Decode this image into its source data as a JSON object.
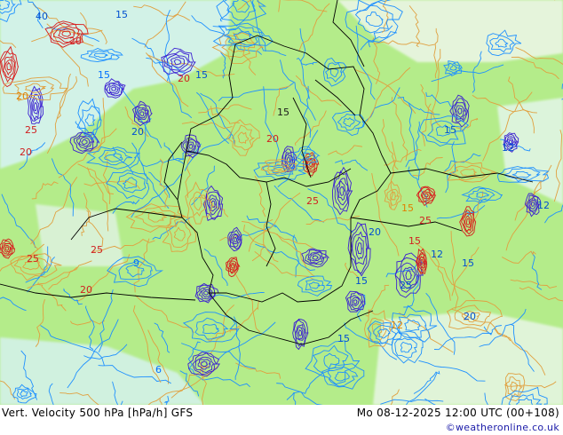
{
  "map": {
    "contour_labels": [
      "40",
      "20",
      "15",
      "20",
      "25",
      "20",
      "15",
      "15",
      "20",
      "25",
      "20",
      "15",
      "25",
      "15",
      "12",
      "25",
      "15",
      "20",
      "12",
      "15",
      "12",
      "20",
      "15",
      "20",
      "25",
      "25",
      "20",
      "15",
      "12",
      "15",
      "9",
      "6"
    ],
    "colors": {
      "background": "#b4ec8a",
      "positive_lines": "#1e90ff",
      "strong_positive_lines": "#3b1fd1",
      "negative_lines": "#e0a040",
      "strong_negative_lines": "#d81c1c",
      "border_lines": "#000000"
    }
  },
  "footer": {
    "title": "Vert. Velocity 500 hPa [hPa/h] GFS",
    "datetime": "Mo 08-12-2025 12:00 UTC (00+108)",
    "credit": "©weatheronline.co.uk"
  }
}
